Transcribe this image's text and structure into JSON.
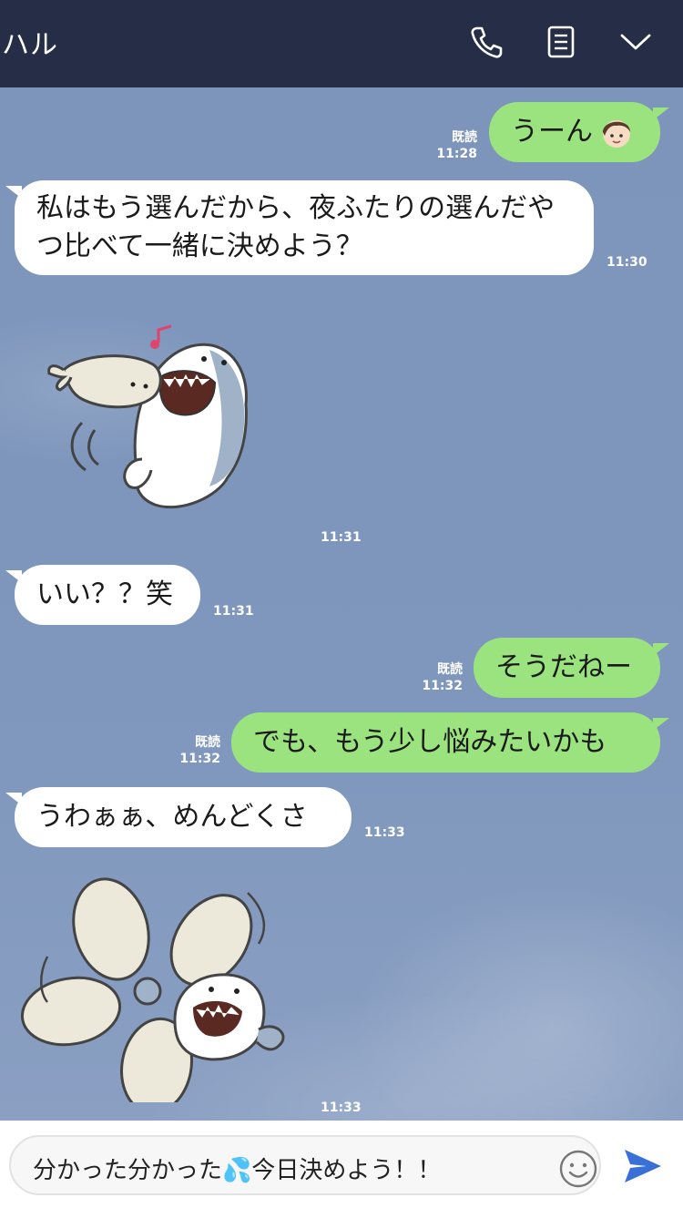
{
  "header": {
    "title": "ハル",
    "icons": [
      "phone-icon",
      "notes-icon",
      "chevron-down-icon"
    ]
  },
  "messages": [
    {
      "side": "out",
      "text": "うーん",
      "has_avatar": true,
      "read": "既読",
      "time": "11:28"
    },
    {
      "side": "in",
      "text": "私はもう選んだから、夜ふたりの選んだやつ比べて一緒に決めよう？",
      "time": "11:30"
    },
    {
      "side": "in",
      "type": "sticker",
      "sticker": "seal-and-shark-sticker",
      "time": "11:31"
    },
    {
      "side": "in",
      "text": "いい？？笑",
      "time": "11:31"
    },
    {
      "side": "out",
      "text": "そうだねー",
      "read": "既読",
      "time": "11:32"
    },
    {
      "side": "out",
      "text": "でも、もう少し悩みたいかも",
      "read": "既読",
      "time": "11:32"
    },
    {
      "side": "in",
      "text": "うわぁぁ、めんどくさ",
      "time": "11:33"
    },
    {
      "side": "in",
      "type": "sticker",
      "sticker": "seal-propeller-shark-sticker",
      "time": "11:33"
    }
  ],
  "input": {
    "value": "分かった分かった💦今日決めよう！！",
    "icons": [
      "emoji-icon",
      "send-icon"
    ]
  },
  "colors": {
    "header": "#252d47",
    "chat_bg": "#7f97bd",
    "out_bubble": "#9be37f",
    "in_bubble": "#ffffff",
    "send": "#3a6fd8"
  }
}
